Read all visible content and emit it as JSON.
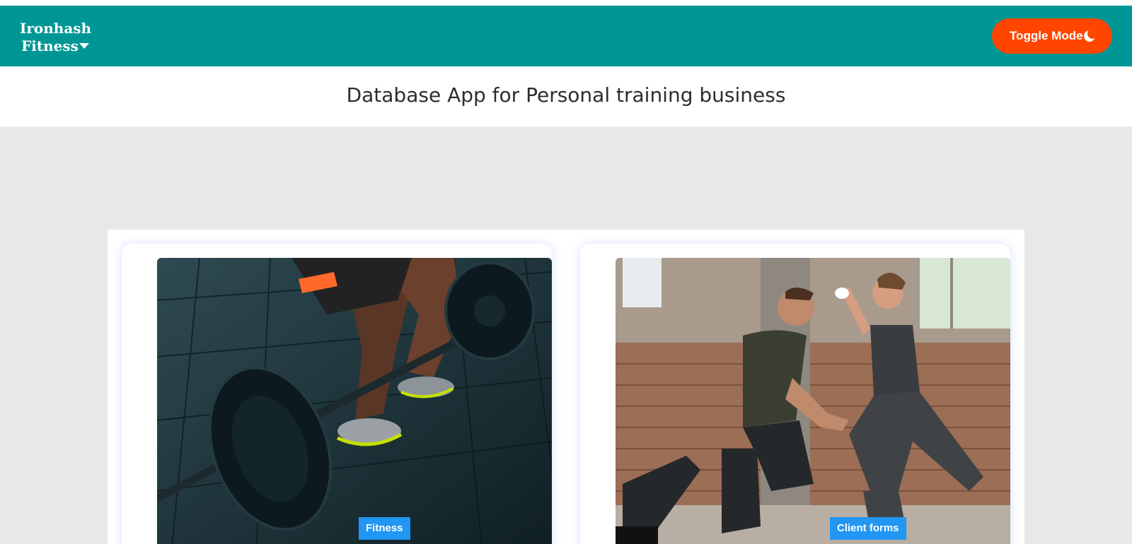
{
  "navbar": {
    "brand_line1": "Ironhash",
    "brand_line2": "Fitness",
    "toggle_label": "Toggle Mode",
    "background": "#009696",
    "toggle_color": "#ff4500"
  },
  "header": {
    "title": "Database App for Personal training business"
  },
  "cards": [
    {
      "badge": "Fitness",
      "image": "barbell-deadlift-photo"
    },
    {
      "badge": "Client forms",
      "image": "trainer-with-client-photo"
    }
  ],
  "colors": {
    "page_bg": "#e8e8e8",
    "badge": "#2196f3"
  }
}
